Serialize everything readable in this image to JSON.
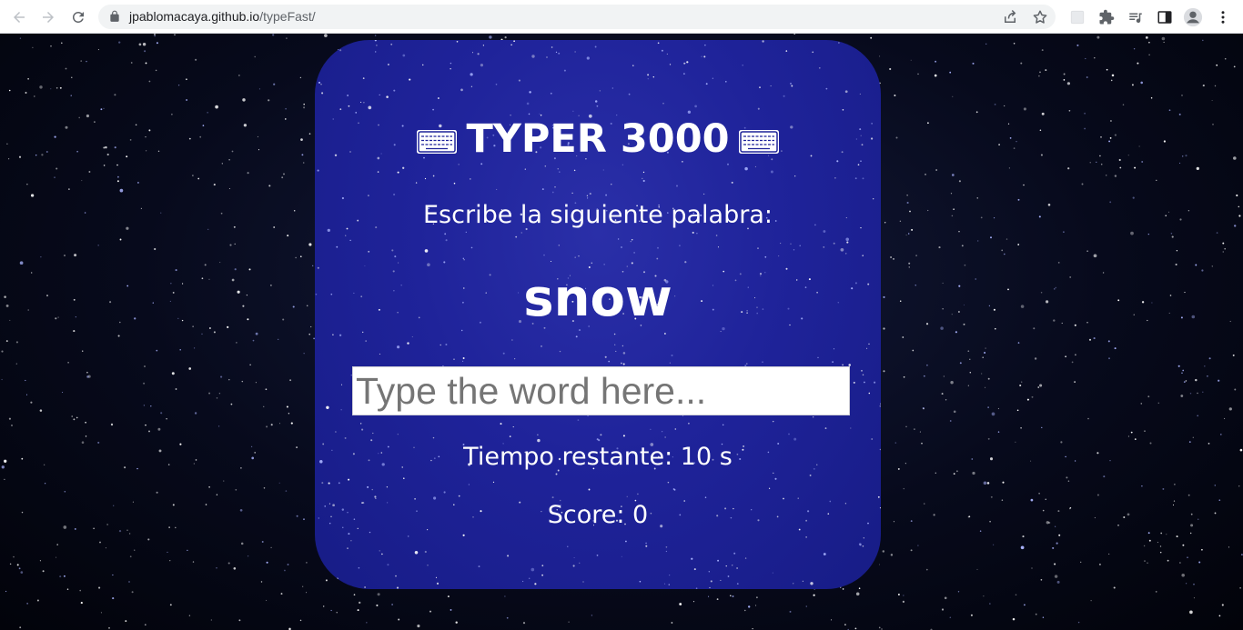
{
  "browser": {
    "url_host": "jpablomacaya.github.io",
    "url_path": "/typeFast/",
    "icons": {
      "back": "back-arrow-icon",
      "forward": "forward-arrow-icon",
      "reload": "reload-icon",
      "lock": "lock-icon",
      "share": "share-icon",
      "bookmark": "star-icon",
      "extensions": "puzzle-icon",
      "media": "media-queue-icon",
      "sidepanel": "side-panel-icon",
      "profile": "profile-icon",
      "menu": "kebab-menu-icon"
    }
  },
  "game": {
    "title_text": "TYPER 3000",
    "title_icon": "keyboard-icon",
    "prompt": "Escribe la siguiente palabra:",
    "word": "snow",
    "input_placeholder": "Type the word here...",
    "time_label": "Tiempo restante: 10 s",
    "score_label": "Score: 0"
  },
  "colors": {
    "card_bg": "#1f239a",
    "text": "#ffffff",
    "page_bg": "#05071a"
  }
}
